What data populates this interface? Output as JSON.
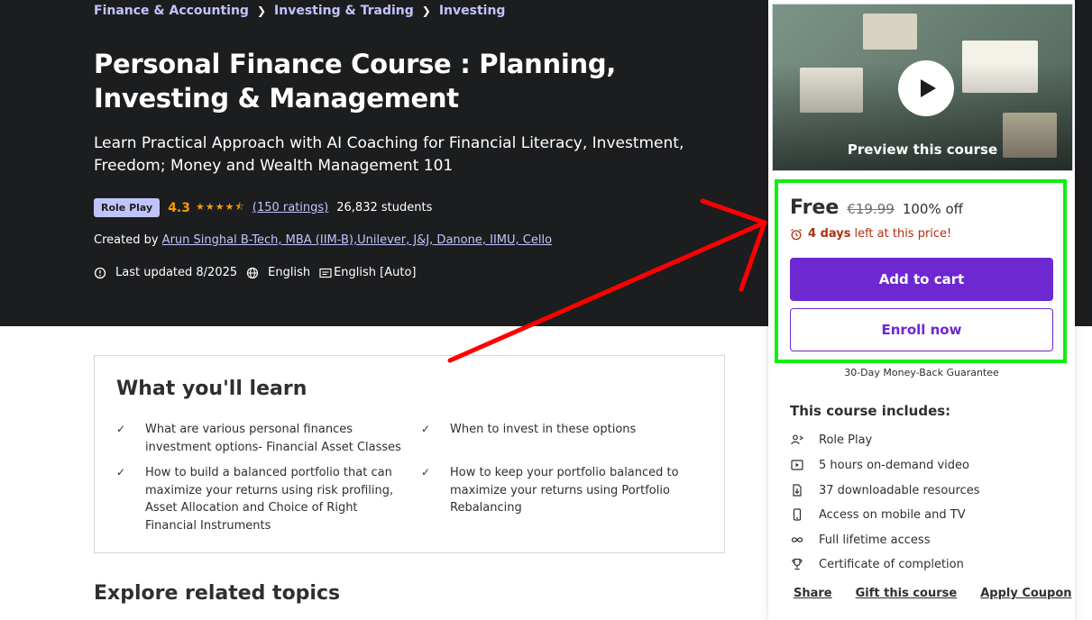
{
  "breadcrumb": [
    "Finance & Accounting",
    "Investing & Trading",
    "Investing"
  ],
  "course": {
    "title": "Personal Finance Course : Planning, Investing & Management",
    "subtitle": "Learn Practical Approach with AI Coaching for Financial Literacy, Investment, Freedom; Money and Wealth Management 101",
    "badge": "Role Play",
    "rating": "4.3",
    "rating_value": 4.3,
    "ratings_count": "(150 ratings)",
    "students": "26,832 students",
    "created_by_label": "Created by",
    "author": "Arun Singhal B-Tech, MBA (IIM-B),Unilever, J&J, Danone, IIMU, Cello",
    "last_updated": "Last updated 8/2025",
    "language": "English",
    "captions": "English [Auto]"
  },
  "learn": {
    "title": "What you'll learn",
    "items": [
      "What are various personal finances investment options- Financial Asset Classes",
      "When to invest in these options",
      "How to build a balanced portfolio that can maximize your returns using risk profiling, Asset Allocation and Choice of Right Financial Instruments",
      "How to keep your portfolio balanced to maximize your returns using Portfolio Rebalancing"
    ]
  },
  "explore": {
    "title": "Explore related topics"
  },
  "sidebar": {
    "preview_label": "Preview this course",
    "price": "Free",
    "original_price": "€19.99",
    "discount": "100% off",
    "timer_bold": "4 days",
    "timer_rest": "left at this price!",
    "add_to_cart": "Add to cart",
    "enroll_now": "Enroll now",
    "guarantee": "30-Day Money-Back Guarantee",
    "includes_title": "This course includes:",
    "includes": [
      {
        "icon": "role-play-icon",
        "label": "Role Play"
      },
      {
        "icon": "video-icon",
        "label": "5 hours on-demand video"
      },
      {
        "icon": "download-file-icon",
        "label": "37 downloadable resources"
      },
      {
        "icon": "mobile-icon",
        "label": "Access on mobile and TV"
      },
      {
        "icon": "infinity-icon",
        "label": "Full lifetime access"
      },
      {
        "icon": "trophy-icon",
        "label": "Certificate of completion"
      }
    ],
    "links": {
      "share": "Share",
      "gift": "Gift this course",
      "coupon": "Apply Coupon"
    }
  },
  "colors": {
    "hero_bg": "#1c1d1f",
    "link_purple": "#c0c4fc",
    "star": "#f69c08",
    "primary": "#6d28d2",
    "timer_red": "#b32d0f",
    "annotation_highlight": "#11ee11",
    "annotation_arrow": "#ff0000"
  }
}
